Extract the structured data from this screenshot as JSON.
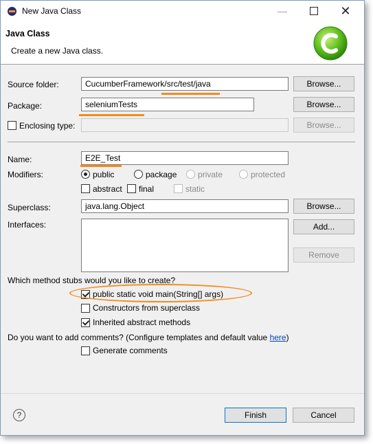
{
  "window": {
    "title": "New Java Class"
  },
  "banner": {
    "title": "Java Class",
    "subtitle": "Create a new Java class."
  },
  "source_folder": {
    "label": "Source folder:",
    "value": "CucumberFramework/src/test/java",
    "browse": "Browse..."
  },
  "package": {
    "label": "Package:",
    "value": "seleniumTests",
    "browse": "Browse..."
  },
  "enclosing": {
    "label": "Enclosing type:",
    "value": "",
    "browse": "Browse...",
    "checked": false
  },
  "name": {
    "label": "Name:",
    "value": "E2E_Test"
  },
  "modifiers": {
    "label": "Modifiers:",
    "public": "public",
    "package": "package",
    "private": "private",
    "protected": "protected",
    "abstract": "abstract",
    "final": "final",
    "static": "static"
  },
  "superclass": {
    "label": "Superclass:",
    "value": "java.lang.Object",
    "browse": "Browse..."
  },
  "interfaces": {
    "label": "Interfaces:",
    "add": "Add...",
    "remove": "Remove"
  },
  "stubs": {
    "question": "Which method stubs would you like to create?",
    "main": "public static void main(String[] args)",
    "constructors": "Constructors from superclass",
    "inherited": "Inherited abstract methods"
  },
  "comments": {
    "question": "Do you want to add comments? (Configure templates and default value ",
    "link": "here",
    "close": ")",
    "generate": "Generate comments"
  },
  "footer": {
    "help": "?",
    "finish": "Finish",
    "cancel": "Cancel"
  },
  "colors": {
    "annotation": "#f28c1c",
    "link": "#0645ad",
    "default_button_border": "#0078d7"
  }
}
